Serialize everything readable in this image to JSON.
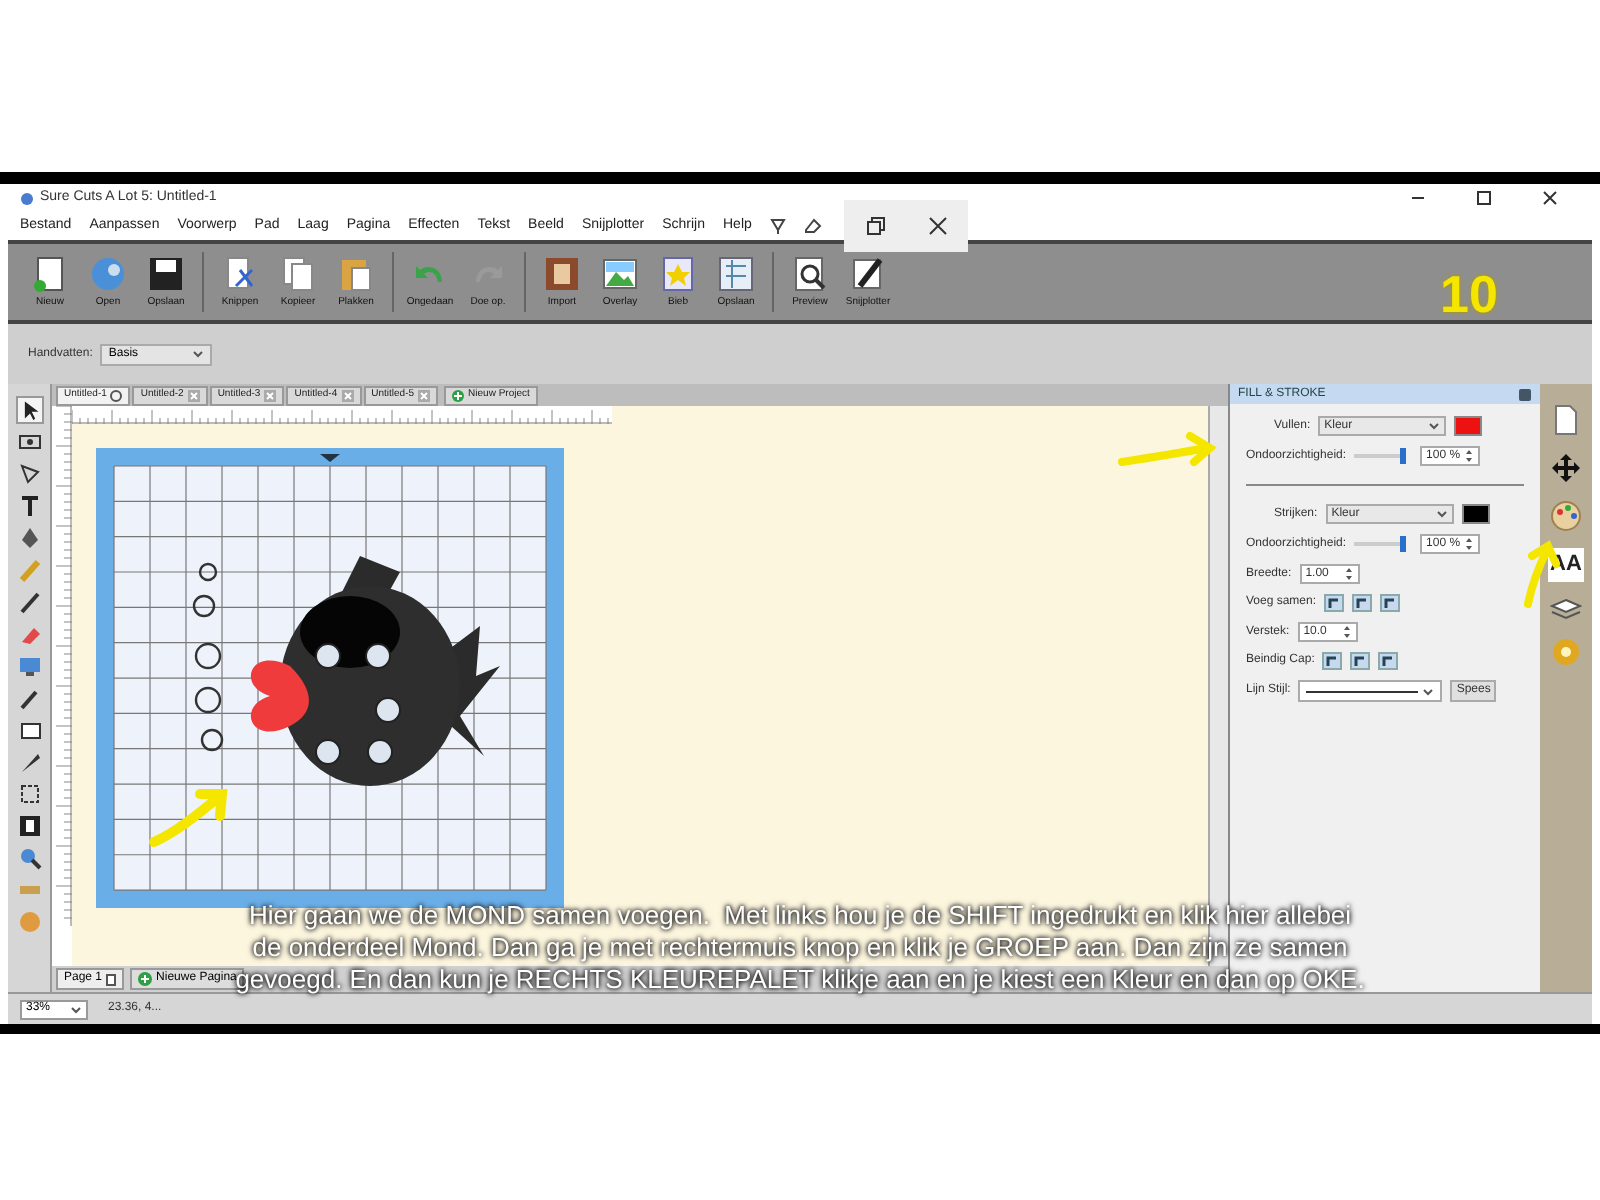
{
  "window": {
    "title": "Sure Cuts A Lot 5: Untitled-1"
  },
  "menu": [
    "Bestand",
    "Aanpassen",
    "Voorwerp",
    "Pad",
    "Laag",
    "Pagina",
    "Effecten",
    "Tekst",
    "Beeld",
    "Snijplotter",
    "Schrijn",
    "Help"
  ],
  "toolbar": [
    {
      "label": "Nieuw",
      "kind": "new"
    },
    {
      "label": "Open",
      "kind": "open"
    },
    {
      "label": "Opslaan",
      "kind": "save"
    },
    {
      "label": "Knippen",
      "kind": "cut"
    },
    {
      "label": "Kopieer",
      "kind": "copy"
    },
    {
      "label": "Plakken",
      "kind": "paste"
    },
    {
      "label": "Ongedaan",
      "kind": "undo"
    },
    {
      "label": "Doe op.",
      "kind": "redo"
    },
    {
      "label": "Import",
      "kind": "import"
    },
    {
      "label": "Overlay",
      "kind": "image"
    },
    {
      "label": "Bieb",
      "kind": "library"
    },
    {
      "label": "Opslaan",
      "kind": "puzzle"
    },
    {
      "label": "Preview",
      "kind": "preview"
    },
    {
      "label": "Snijplotter",
      "kind": "cutter"
    }
  ],
  "step_number": "10",
  "handles": {
    "label": "Handvatten:",
    "value": "Basis"
  },
  "tabs": [
    {
      "label": "Untitled-1",
      "selected": true
    },
    {
      "label": "Untitled-2",
      "selected": false
    },
    {
      "label": "Untitled-3",
      "selected": false
    },
    {
      "label": "Untitled-4",
      "selected": false
    },
    {
      "label": "Untitled-5",
      "selected": false
    }
  ],
  "new_project": "Nieuw Project",
  "panel": {
    "title": "FILL & STROKE",
    "fill": {
      "label": "Vullen:",
      "value": "Kleur",
      "color": "#ee1111",
      "opacity_label": "Ondoorzichtigheid:",
      "opacity": "100 %",
      "level": 1
    },
    "stroke": {
      "label": "Strijken:",
      "value": "Kleur",
      "color": "#000000",
      "opacity_label": "Ondoorzichtigheid:",
      "opacity": "100 %",
      "level": 1
    },
    "width": {
      "label": "Breedte:",
      "value": "1.00"
    },
    "join": {
      "label": "Voeg samen:"
    },
    "miter": {
      "label": "Verstek:",
      "value": "10.0"
    },
    "cap": {
      "label": "Beindig Cap:"
    },
    "line_style": {
      "label": "Lijn Stijl:",
      "button": "Spees"
    }
  },
  "side_icons": [
    "AA"
  ],
  "pages": {
    "page": "Page 1",
    "new_page": "Nieuwe Pagina"
  },
  "status": {
    "zoom": "33%",
    "coords": "23.36, 4..."
  },
  "caption": [
    "Hier gaan we de MOND samen voegen.  Met links hou je de SHIFT ingedrukt en klik hier allebei",
    "de onderdeel Mond. Dan ga je met rechtermuis knop en klik je GROEP aan. Dan zijn ze samen",
    "gevoegd. En dan kun je RECHTS KLEUREPALET klikje aan en je kiest een Kleur en dan op OKE."
  ]
}
